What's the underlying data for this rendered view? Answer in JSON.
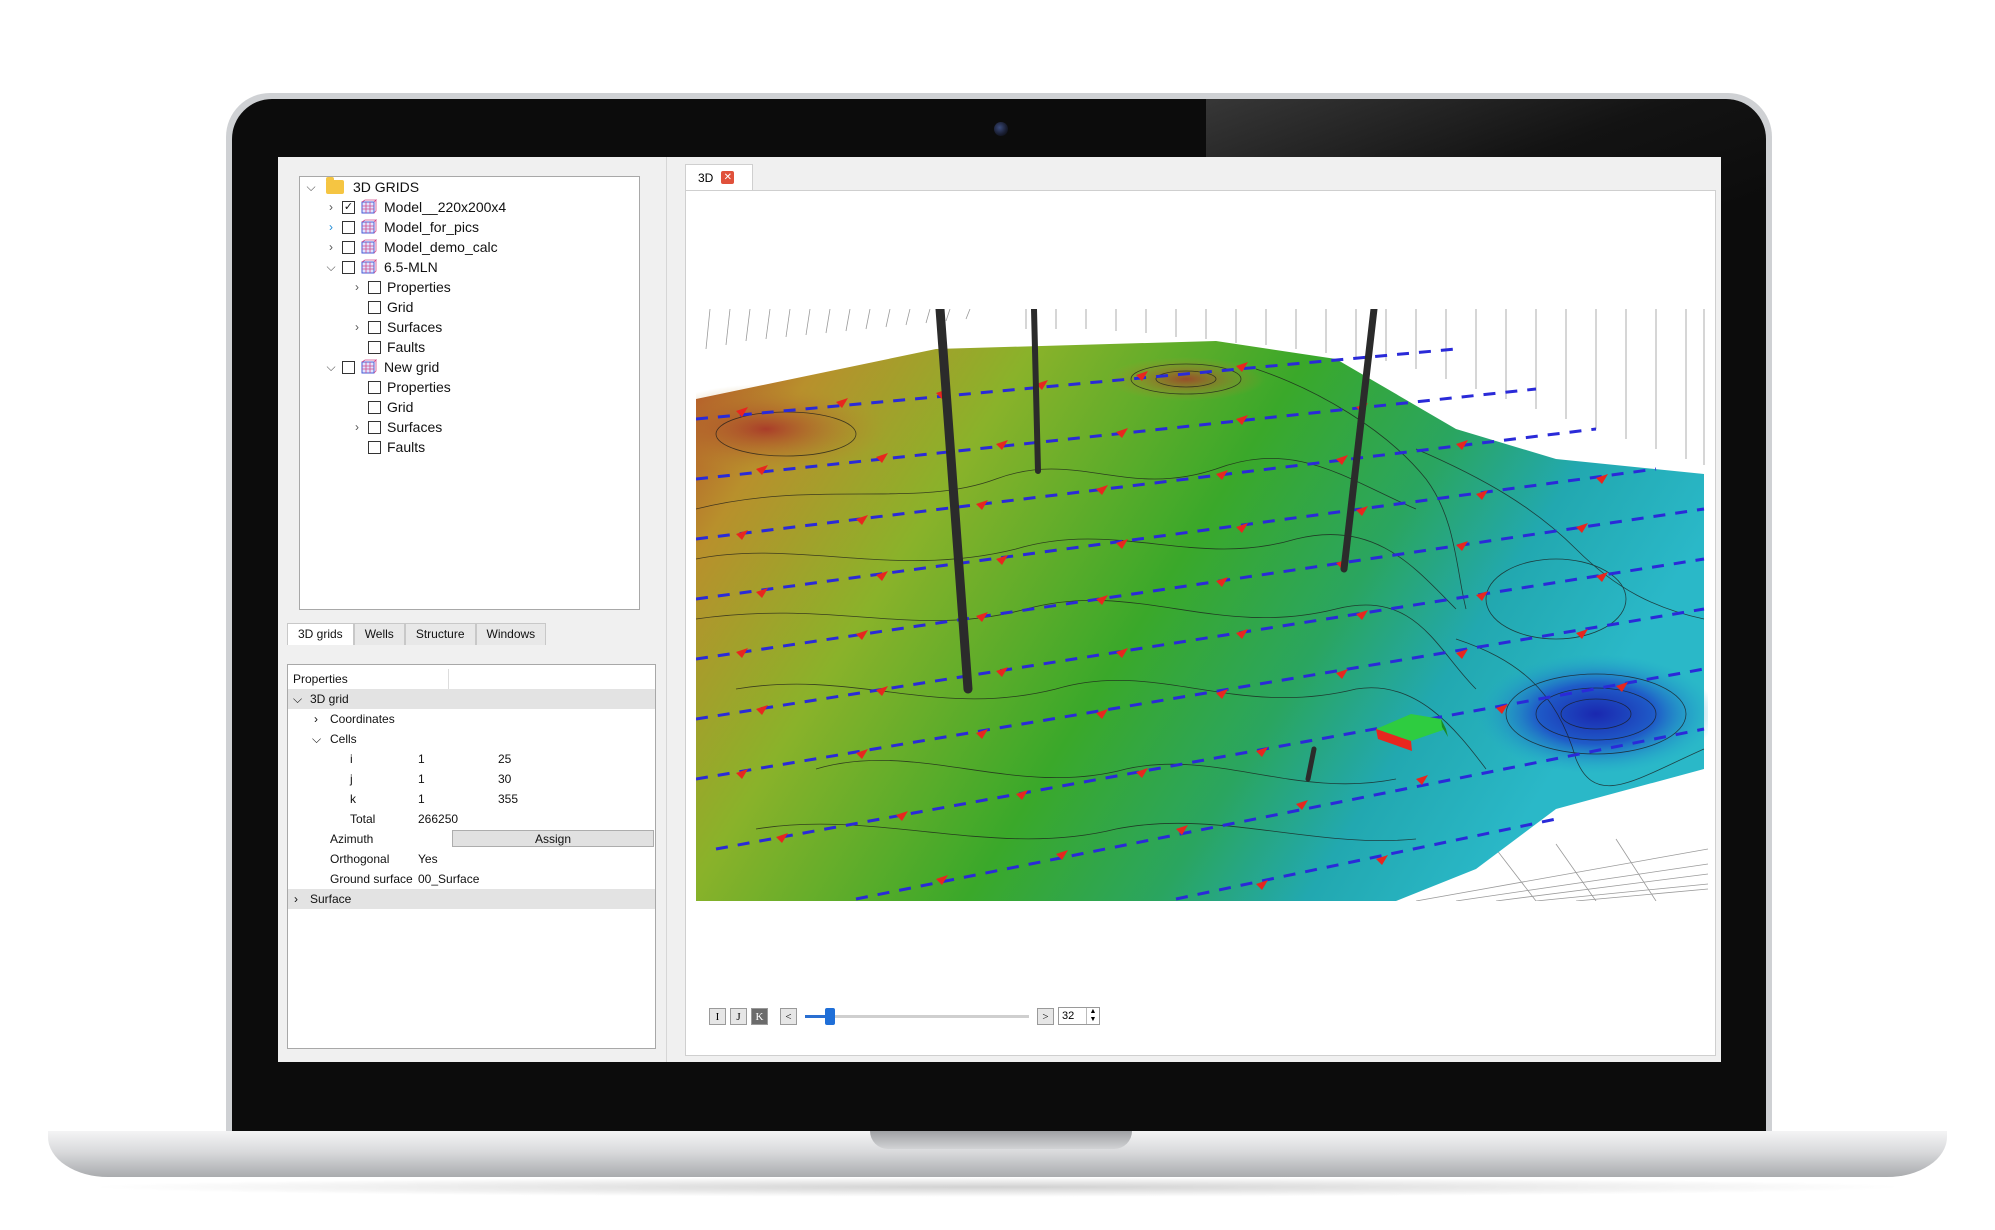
{
  "tree": {
    "root": "3D GRIDS",
    "models": [
      {
        "label": "Model__220x200x4",
        "checked": true
      },
      {
        "label": "Model_for_pics",
        "checked": false
      },
      {
        "label": "Model_demo_calc",
        "checked": false
      },
      {
        "label": "6.5-MLN",
        "checked": false
      }
    ],
    "mln_children": [
      "Properties",
      "Grid",
      "Surfaces",
      "Faults"
    ],
    "new_grid": "New grid",
    "new_grid_children": [
      "Properties",
      "Grid",
      "Surfaces",
      "Faults"
    ]
  },
  "bottom_tabs": [
    "3D grids",
    "Wells",
    "Structure",
    "Windows"
  ],
  "properties": {
    "header": "Properties",
    "section_3d_grid": "3D grid",
    "coordinates": "Coordinates",
    "cells": "Cells",
    "i_label": "i",
    "i_from": "1",
    "i_to": "25",
    "j_label": "j",
    "j_from": "1",
    "j_to": "30",
    "k_label": "k",
    "k_from": "1",
    "k_to": "355",
    "total_label": "Total",
    "total_value": "266250",
    "azimuth_label": "Azimuth",
    "assign_button": "Assign",
    "orthogonal_label": "Orthogonal",
    "orthogonal_value": "Yes",
    "ground_label": "Ground surface",
    "ground_value": "00_Surface",
    "section_surface": "Surface"
  },
  "view": {
    "tab_label": "3D",
    "close_glyph": "✕",
    "axis_buttons": [
      "I",
      "J",
      "K"
    ],
    "active_axis": "K",
    "prev": "<",
    "next": ">",
    "slice_value": "32",
    "slider_fraction": 0.09
  },
  "colors": {
    "accent": "#1f6fd8",
    "close": "#e0513b",
    "folder": "#f5c542"
  }
}
